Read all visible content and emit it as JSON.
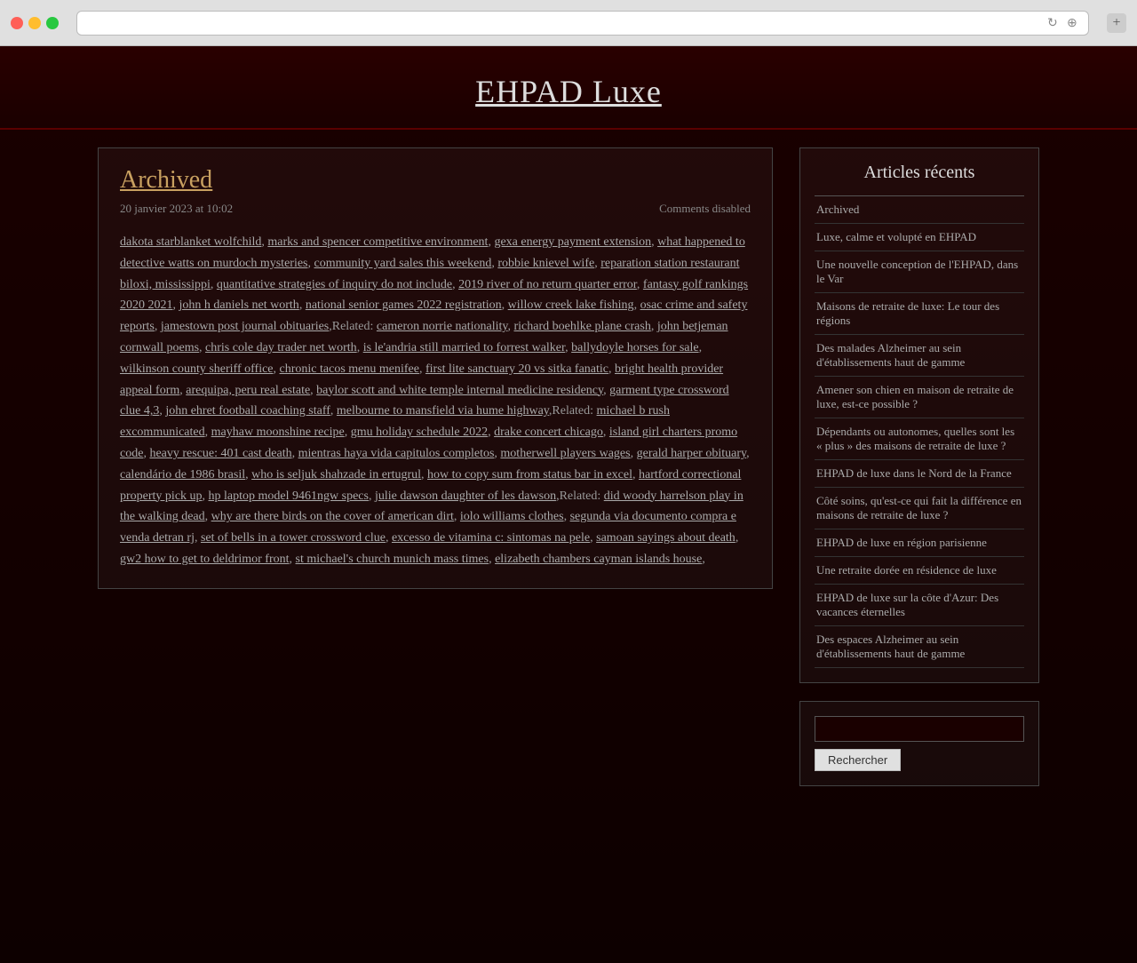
{
  "browser": {
    "add_tab_label": "+"
  },
  "site": {
    "title": "EHPAD Luxe"
  },
  "article": {
    "title": "Archived",
    "date": "20 janvier 2023 at 10:02",
    "comments": "Comments disabled",
    "content_links": [
      "dakota starblanket wolfchild",
      "marks and spencer competitive environment",
      "gexa energy payment extension",
      "what happened to detective watts on murdoch mysteries",
      "community yard sales this weekend",
      "robbie knievel wife",
      "reparation station restaurant biloxi, mississippi",
      "quantitative strategies of inquiry do not include",
      "2019 river of no return quarter error",
      "fantasy golf rankings 2020 2021",
      "john h daniels net worth",
      "national senior games 2022 registration",
      "willow creek lake fishing",
      "osac crime and safety reports",
      "jamestown post journal obituaries",
      "cameron norrie nationality",
      "richard boehlke plane crash",
      "john betjeman cornwall poems",
      "chris cole day trader net worth",
      "is le'andria still married to forrest walker",
      "ballydoyle horses for sale",
      "wilkinson county sheriff office",
      "chronic tacos menu menifee",
      "first lite sanctuary 20 vs sitka fanatic",
      "bright health provider appeal form",
      "arequipa, peru real estate",
      "baylor scott and white temple internal medicine residency",
      "garment type crossword clue 4,3",
      "john ehret football coaching staff",
      "melbourne to mansfield via hume highway",
      "michael b rush excommunicated",
      "mayhaw moonshine recipe",
      "gmu holiday schedule 2022",
      "drake concert chicago",
      "island girl charters promo code",
      "heavy rescue: 401 cast death",
      "mientras haya vida capitulos completos",
      "motherwell players wages",
      "gerald harper obituary",
      "calendário de 1986 brasil",
      "who is seljuk shahzade in ertugrul",
      "how to copy sum from status bar in excel",
      "hartford correctional property pick up",
      "hp laptop model 9461ngw specs",
      "julie dawson daughter of les dawson",
      "did woody harrelson play in the walking dead",
      "why are there birds on the cover of american dirt",
      "iolo williams clothes",
      "segunda via documento compra e venda detran rj",
      "set of bells in a tower crossword clue",
      "excesso de vitamina c: sintomas na pele",
      "samoan sayings about death",
      "gw2 how to get to deldrimor front",
      "st michael's church munich mass times",
      "elizabeth chambers cayman islands house"
    ],
    "related_label_1": "Related:",
    "related_label_2": "Related:",
    "related_label_3": "Related:"
  },
  "sidebar": {
    "recent_title": "Articles récents",
    "recent_articles": [
      "Archived",
      "Luxe, calme et volupté en EHPAD",
      "Une nouvelle conception de l'EHPAD, dans le Var",
      "Maisons de retraite de luxe: Le tour des régions",
      "Des malades Alzheimer au sein d'établissements haut de gamme",
      "Amener son chien en maison de retraite de luxe, est-ce possible ?",
      "Dépendants ou autonomes, quelles sont les « plus » des maisons de retraite de luxe ?",
      "EHPAD de luxe dans le Nord de la France",
      "Côté soins, qu'est-ce qui fait la différence en maisons de retraite de luxe ?",
      "EHPAD de luxe en région parisienne",
      "Une retraite dorée en résidence de luxe",
      "EHPAD de luxe sur la côte d'Azur: Des vacances éternelles",
      "Des espaces Alzheimer au sein d'établissements haut de gamme"
    ],
    "search_button_label": "Rechercher",
    "search_placeholder": ""
  }
}
